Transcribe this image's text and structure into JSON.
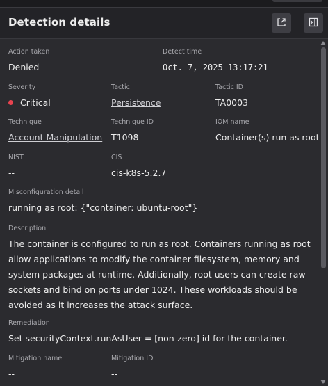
{
  "panel": {
    "title": "Detection details",
    "export_icon": "export-icon",
    "collapse_icon": "collapse-panel-icon"
  },
  "fields": {
    "action_taken": {
      "label": "Action taken",
      "value": "Denied"
    },
    "detect_time": {
      "label": "Detect time",
      "value": "Oct. 7, 2025 13:17:21"
    },
    "severity": {
      "label": "Severity",
      "value": "Critical",
      "color": "#e8434f"
    },
    "tactic": {
      "label": "Tactic",
      "value": "Persistence"
    },
    "tactic_id": {
      "label": "Tactic ID",
      "value": "TA0003"
    },
    "technique": {
      "label": "Technique",
      "value": "Account Manipulation"
    },
    "technique_id": {
      "label": "Technique ID",
      "value": "T1098"
    },
    "iom_name": {
      "label": "IOM name",
      "value": "Container(s) run as root"
    },
    "nist": {
      "label": "NIST",
      "value": "--"
    },
    "cis": {
      "label": "CIS",
      "value": "cis-k8s-5.2.7"
    },
    "misconfiguration_detail": {
      "label": "Misconfiguration detail",
      "value": "running as root: {\"container: ubuntu-root\"}"
    },
    "description": {
      "label": "Description",
      "value": "The container is configured to run as root. Containers running as root allow applications to modify the container filesystem, memory and system packages at runtime. Additionally, root users can create raw sockets and bind on ports under 1024. These workloads should be avoided as it increases the attack surface."
    },
    "remediation": {
      "label": "Remediation",
      "value": "Set securityContext.runAsUser = [non-zero] id for the container."
    },
    "mitigation_name": {
      "label": "Mitigation name",
      "value": "--"
    },
    "mitigation_id": {
      "label": "Mitigation ID",
      "value": "--"
    }
  }
}
